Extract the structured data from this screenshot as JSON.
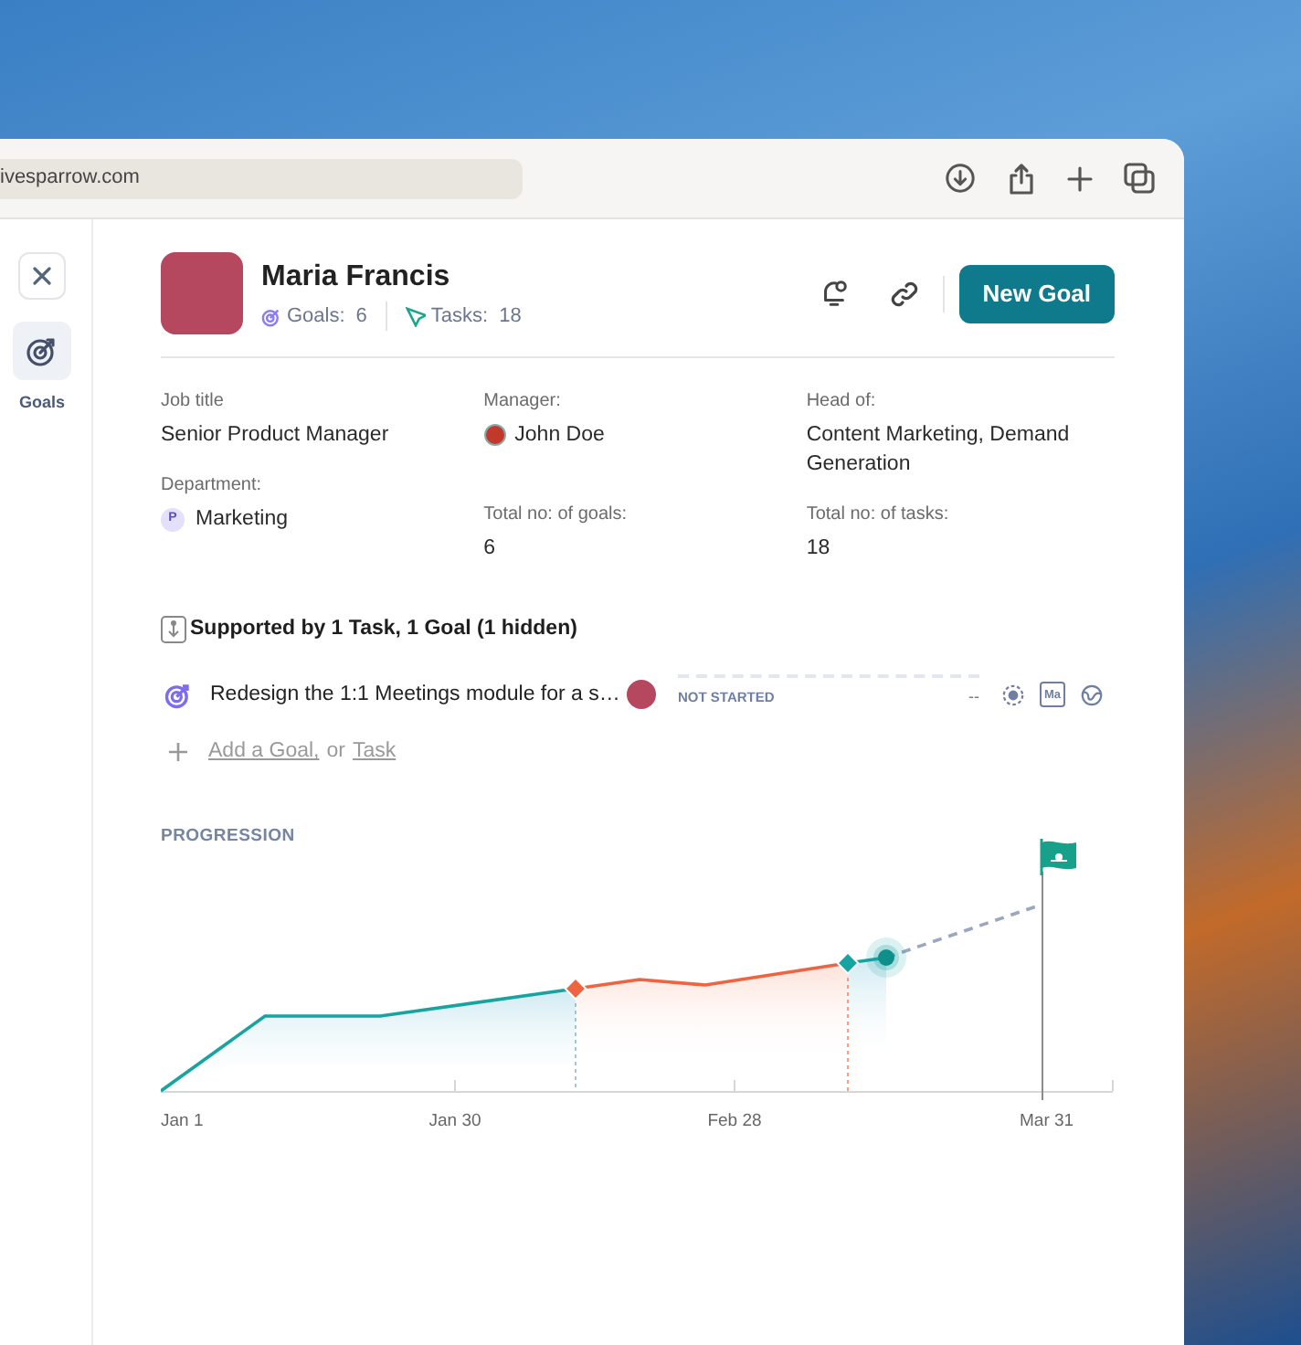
{
  "browser": {
    "url": "ivesparrow.com"
  },
  "sidebar": {
    "items": [
      {
        "label": "Goals",
        "selected": true
      }
    ]
  },
  "profile": {
    "name": "Maria Francis",
    "stats": [
      {
        "kind": "goals",
        "label": "Goals:",
        "value": "6"
      },
      {
        "kind": "tasks",
        "label": "Tasks:",
        "value": "18"
      }
    ],
    "primary_button": "New Goal"
  },
  "detail_columns": [
    {
      "fields": [
        {
          "kind": "text",
          "label": "Job title",
          "value": "Senior Product Manager"
        },
        {
          "kind": "badge",
          "label": "Department:",
          "badge": "P",
          "value": "Marketing"
        }
      ]
    },
    {
      "fields": [
        {
          "kind": "person",
          "label": "Manager:",
          "value": "John Doe"
        },
        {
          "kind": "text",
          "label": "Total no: of goals:",
          "value": "6"
        }
      ]
    },
    {
      "fields": [
        {
          "kind": "text",
          "label": "Head of:",
          "value": "Content Marketing, Demand Generation"
        },
        {
          "kind": "text",
          "label": "Total no: of tasks:",
          "value": "18"
        }
      ]
    }
  ],
  "supporting": {
    "title": "Supported by 1 Task, 1 Goal (1 hidden)",
    "items": [
      {
        "title": "Redesign the 1:1 Meetings module for a s…",
        "status": "NOT STARTED",
        "value": "--",
        "date": "Ma"
      }
    ],
    "add": {
      "goal_link": "Add a Goal,",
      "joiner": "or",
      "task_link": "Task"
    }
  },
  "progression": {
    "title": "PROGRESSION",
    "x_labels": [
      "Jan 1",
      "Jan 30",
      "Feb 28",
      "Mar 31"
    ]
  }
}
